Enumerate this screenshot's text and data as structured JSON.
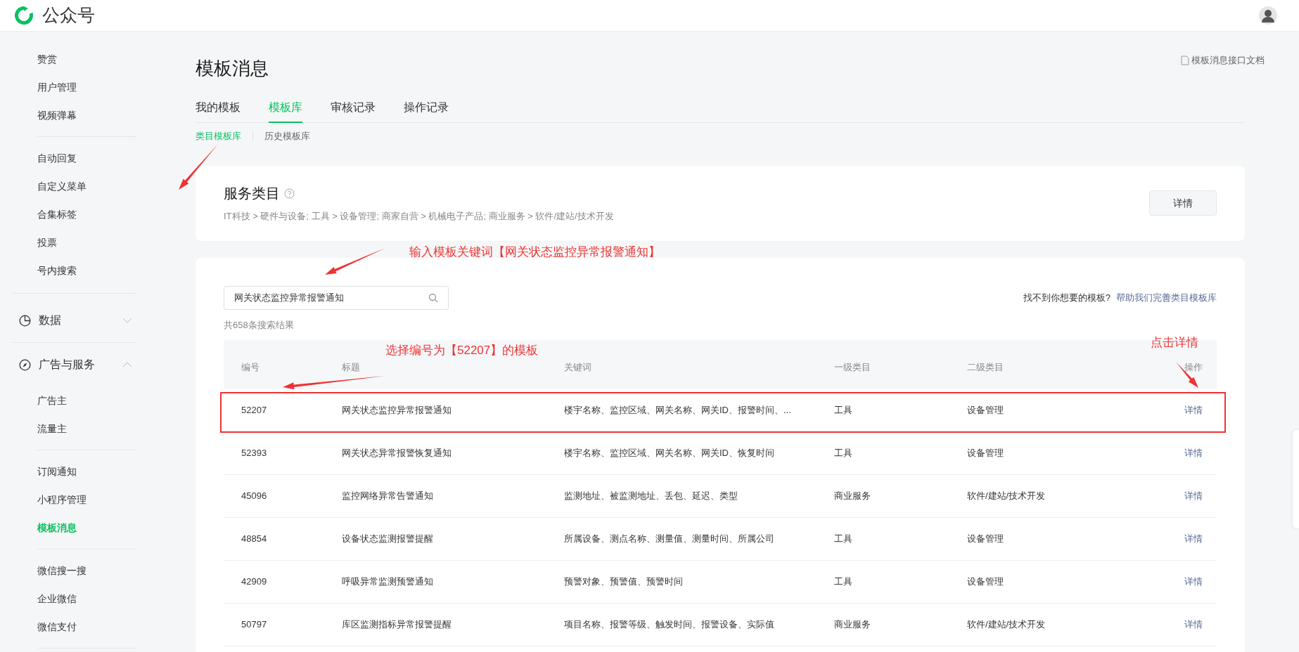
{
  "header": {
    "brand": "公众号"
  },
  "sidebar": {
    "sections": [
      {
        "items": [
          {
            "label": "赞赏",
            "selected": false
          },
          {
            "label": "用户管理",
            "selected": false
          },
          {
            "label": "视频弹幕",
            "selected": false
          }
        ]
      },
      {
        "items": [
          {
            "label": "自动回复",
            "selected": false
          },
          {
            "label": "自定义菜单",
            "selected": false
          },
          {
            "label": "合集标签",
            "selected": false
          },
          {
            "label": "投票",
            "selected": false
          },
          {
            "label": "号内搜索",
            "selected": false
          }
        ]
      },
      {
        "heading": {
          "label": "数据",
          "expanded": false
        }
      },
      {
        "heading": {
          "label": "广告与服务",
          "expanded": true
        },
        "items": [
          {
            "label": "广告主",
            "selected": false
          },
          {
            "label": "流量主",
            "selected": false
          }
        ]
      },
      {
        "items": [
          {
            "label": "订阅通知",
            "selected": false
          },
          {
            "label": "小程序管理",
            "selected": false
          },
          {
            "label": "模板消息",
            "selected": true
          }
        ]
      },
      {
        "items": [
          {
            "label": "微信搜一搜",
            "selected": false
          },
          {
            "label": "企业微信",
            "selected": false
          },
          {
            "label": "微信支付",
            "selected": false
          }
        ]
      }
    ]
  },
  "page": {
    "title": "模板消息",
    "doc_link": "模板消息接口文档",
    "tabs": [
      {
        "label": "我的模板",
        "selected": false
      },
      {
        "label": "模板库",
        "selected": true
      },
      {
        "label": "审核记录",
        "selected": false
      },
      {
        "label": "操作记录",
        "selected": false
      }
    ],
    "subtabs": [
      {
        "label": "类目模板库",
        "selected": true
      },
      {
        "label": "历史模板库",
        "selected": false
      }
    ],
    "service_category": {
      "title": "服务类目",
      "path": "IT科技 > 硬件与设备; 工具 > 设备管理; 商家自营 > 机械电子产品; 商业服务 > 软件/建站/技术开发",
      "button": "详情"
    },
    "search": {
      "value": "网关状态监控异常报警通知",
      "result_count": "共658条搜索结果",
      "help_text": "找不到你想要的模板?",
      "help_link": "帮助我们完善类目模板库"
    },
    "table": {
      "columns": [
        "编号",
        "标题",
        "关键词",
        "一级类目",
        "二级类目",
        "操作"
      ],
      "rows": [
        {
          "cells": [
            "52207",
            "网关状态监控异常报警通知",
            "楼宇名称、监控区域、网关名称、网关ID、报警时间、...",
            "工具",
            "设备管理",
            "详情"
          ],
          "highlighted": true
        },
        {
          "cells": [
            "52393",
            "网关状态异常报警恢复通知",
            "楼宇名称、监控区域、网关名称、网关ID、恢复时间",
            "工具",
            "设备管理",
            "详情"
          ],
          "highlighted": false
        },
        {
          "cells": [
            "45096",
            "监控网络异常告警通知",
            "监测地址、被监测地址、丢包、延迟、类型",
            "商业服务",
            "软件/建站/技术开发",
            "详情"
          ],
          "highlighted": false
        },
        {
          "cells": [
            "48854",
            "设备状态监测报警提醒",
            "所属设备、测点名称、测量值、测量时间、所属公司",
            "工具",
            "设备管理",
            "详情"
          ],
          "highlighted": false
        },
        {
          "cells": [
            "42909",
            "呼吸异常监测预警通知",
            "预警对象、预警值、预警时间",
            "工具",
            "设备管理",
            "详情"
          ],
          "highlighted": false
        },
        {
          "cells": [
            "50797",
            "库区监测指标异常报警提醒",
            "项目名称、报警等级、触发时间、报警设备、实际值",
            "商业服务",
            "软件/建站/技术开发",
            "详情"
          ],
          "highlighted": false
        }
      ]
    }
  },
  "annotations": [
    {
      "text": "输入模板关键词【网关状态监控异常报警通知】"
    },
    {
      "text": "选择编号为【52207】的模板"
    },
    {
      "text": "点击详情"
    }
  ]
}
